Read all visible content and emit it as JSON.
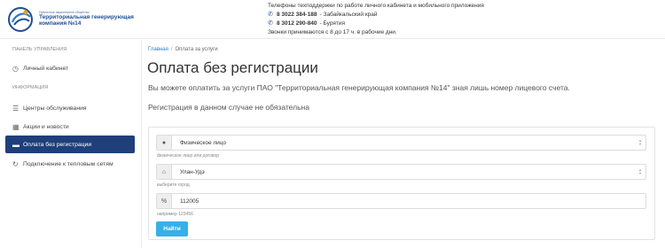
{
  "header": {
    "logo_small_text": "Публичное акционерное общество",
    "logo_name_line1": "Территориальная генерирующая",
    "logo_name_line2": "компания №14",
    "support_title": "Телефоны техподдержки по работе личного кабинета и мобильного приложения",
    "phones": [
      {
        "number": "8 3022 384-188",
        "region": "- Забайкальский край"
      },
      {
        "number": "8 3012 290-840",
        "region": "- Бурятия"
      }
    ],
    "hours": "Звонки принимаются с 8 до 17 ч. в рабочие дни."
  },
  "sidebar": {
    "section_panel": "Панель управления",
    "cabinet": "Личный кабинет",
    "section_info": "Информация",
    "items": [
      {
        "label": "Центры обслуживания",
        "icon": "list-icon"
      },
      {
        "label": "Акции и новости",
        "icon": "calendar-icon"
      },
      {
        "label": "Оплата без регистрации",
        "icon": "folder-icon"
      },
      {
        "label": "Подключение к тепловым сетям",
        "icon": "refresh-icon"
      }
    ]
  },
  "breadcrumb": {
    "home": "Главная",
    "separator": "/",
    "current": "Оплата за услуги"
  },
  "main": {
    "title": "Оплата без регистрации",
    "description": "Вы можете оплатить за услуги ПАО \"Территориальная генерирующая компания №14\" зная лишь номер лицевого счета.",
    "note": "Регистрация в данном случае не обязательна"
  },
  "form": {
    "person_value": "Физическое лицо",
    "person_help": "физическое лицо или договор",
    "city_value": "Улан-Удэ",
    "city_help": "выберите город",
    "account_value": "112005",
    "account_help": "например 123456",
    "submit": "Найти"
  },
  "colors": {
    "active_nav": "#1f3f7a",
    "button": "#36b0e8",
    "link": "#2a7fc9"
  }
}
